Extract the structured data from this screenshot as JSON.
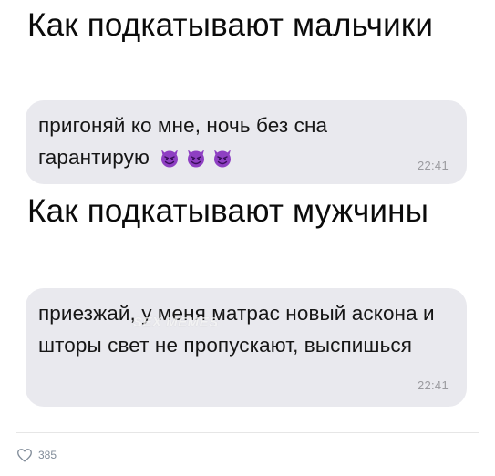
{
  "post": {
    "heading_boys": "Как подкатывают мальчики",
    "message_boys": "пригоняй ко мне, ночь без сна гарантирую",
    "time_boys": "22:41",
    "emoji": [
      "smiling-imp-emoji",
      "smiling-imp-emoji",
      "smiling-imp-emoji"
    ],
    "heading_men": "Как подкатывают мужчины",
    "message_men": "приезжай, у меня матрас новый аскона и шторы свет не пропускают, выспишься",
    "time_men": "22:41",
    "watermark": "SEX MEMES"
  },
  "footer": {
    "like_icon": "heart-icon",
    "like_count": "385"
  },
  "colors": {
    "bubble": "#e9e9ee",
    "emoji_purple": "#8e3fc2",
    "meta_gray": "#818c99"
  }
}
